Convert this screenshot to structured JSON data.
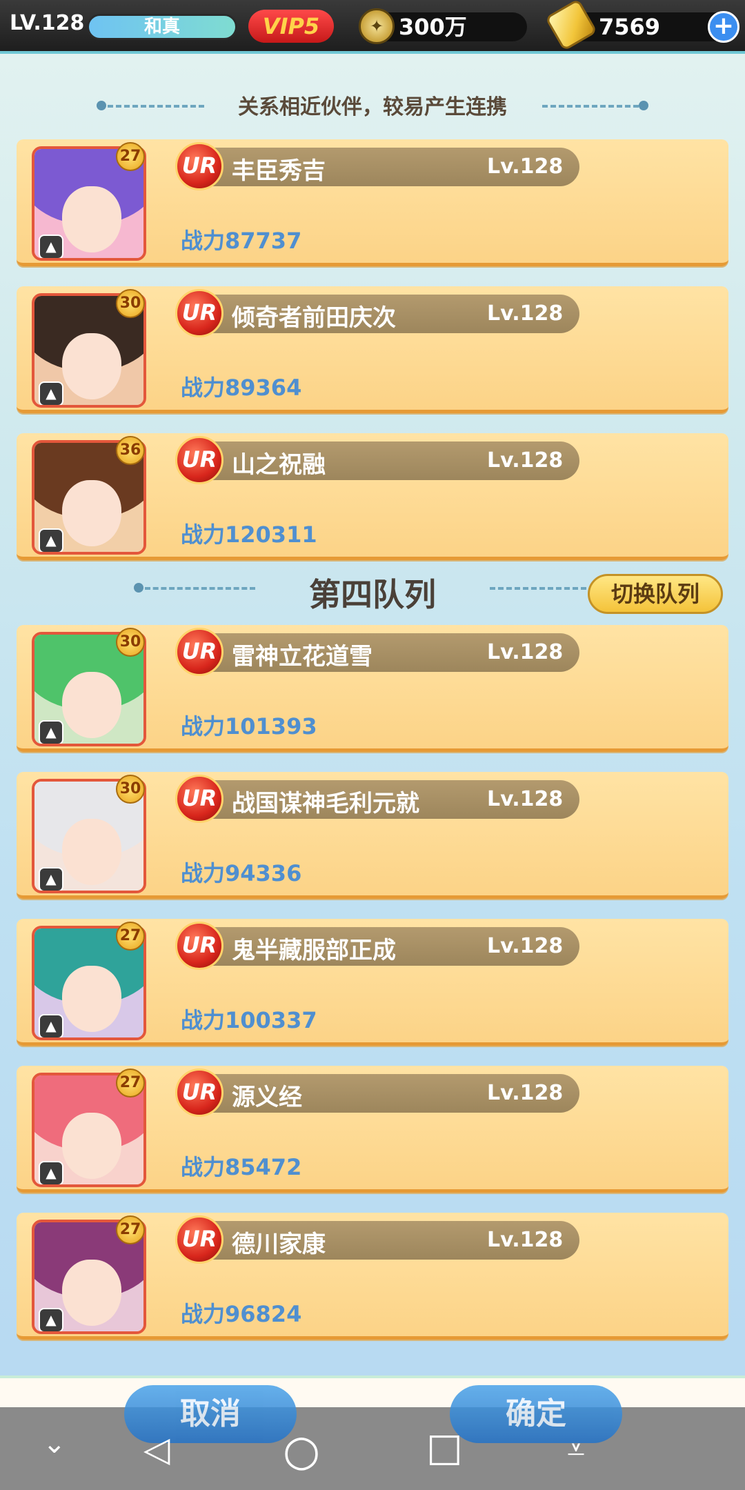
{
  "topbar": {
    "level": "LV.128",
    "player_name": "和真",
    "vip": "VIP5",
    "coins": "300万",
    "gold": "7569",
    "plus": "+"
  },
  "section_top": {
    "subtitle": "关系相近伙伴，较易产生连携"
  },
  "section_queue": {
    "title": "第四队列",
    "switch_label": "切换队列"
  },
  "heroes_top": [
    {
      "stars": "27",
      "rarity": "UR",
      "name": "丰臣秀吉",
      "level": "Lv.128",
      "power": "战力87737"
    },
    {
      "stars": "30",
      "rarity": "UR",
      "name": "倾奇者前田庆次",
      "level": "Lv.128",
      "power": "战力89364"
    },
    {
      "stars": "36",
      "rarity": "UR",
      "name": "山之祝融",
      "level": "Lv.128",
      "power": "战力120311"
    }
  ],
  "heroes_queue": [
    {
      "stars": "30",
      "rarity": "UR",
      "name": "雷神立花道雪",
      "level": "Lv.128",
      "power": "战力101393"
    },
    {
      "stars": "30",
      "rarity": "UR",
      "name": "战国谋神毛利元就",
      "level": "Lv.128",
      "power": "战力94336"
    },
    {
      "stars": "27",
      "rarity": "UR",
      "name": "鬼半藏服部正成",
      "level": "Lv.128",
      "power": "战力100337"
    },
    {
      "stars": "27",
      "rarity": "UR",
      "name": "源义经",
      "level": "Lv.128",
      "power": "战力85472"
    },
    {
      "stars": "27",
      "rarity": "UR",
      "name": "德川家康",
      "level": "Lv.128",
      "power": "战力96824"
    }
  ],
  "actions": {
    "cancel": "取消",
    "confirm": "确定"
  },
  "navbar": {
    "chevron_icon": "⌄",
    "back_icon": "◁",
    "home_icon": "○",
    "recents_icon": "□",
    "keyboard_icon": "⩡"
  }
}
